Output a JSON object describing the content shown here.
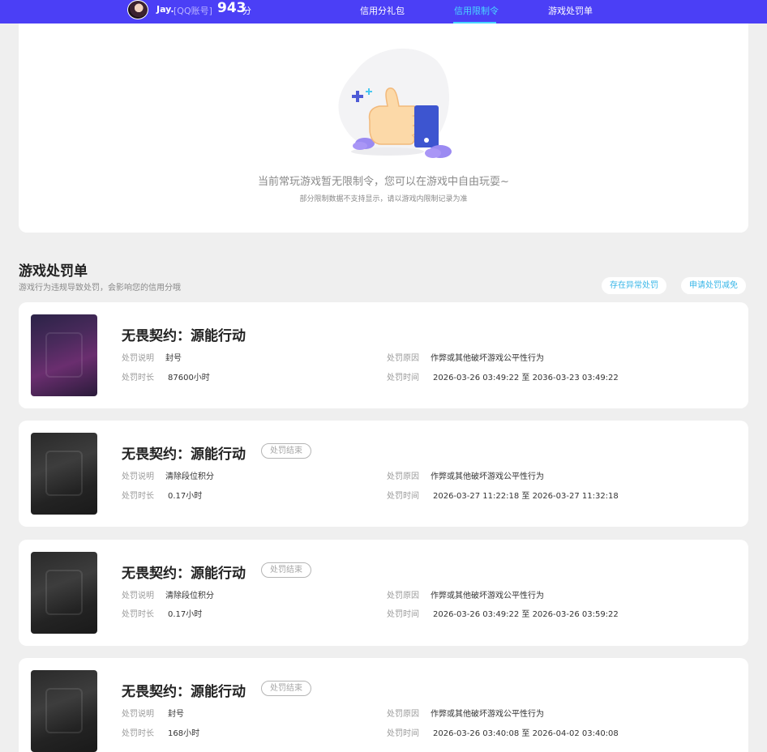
{
  "header": {
    "user_name": "Jay.",
    "account_type": "[QQ账号]",
    "score": "943",
    "score_unit": "分",
    "nav": [
      {
        "label": "信用分礼包",
        "active": false
      },
      {
        "label": "信用限制令",
        "active": true
      },
      {
        "label": "游戏处罚单",
        "active": false
      }
    ]
  },
  "hero": {
    "main_text": "当前常玩游戏暂无限制令，您可以在游戏中自由玩耍~",
    "sub_text": "部分限制数据不支持显示，请以游戏内限制记录为准"
  },
  "section": {
    "title": "游戏处罚单",
    "description": "游戏行为违规导致处罚，会影响您的信用分哦",
    "buttons": [
      "存在异常处罚",
      "申请处罚减免"
    ]
  },
  "labels": {
    "desc": "处罚说明",
    "duration": "处罚时长",
    "reason": "处罚原因",
    "time": "处罚时间",
    "ended": "处罚结束"
  },
  "punishments": [
    {
      "game": "无畏契约：源能行动",
      "ended": false,
      "desc": "封号",
      "duration": "87600小时",
      "reason": "作弊或其他破坏游戏公平性行为",
      "time": "2026-03-26 03:49:22 至 2036-03-23 03:49:22"
    },
    {
      "game": "无畏契约：源能行动",
      "ended": true,
      "desc": "清除段位积分",
      "duration": "0.17小时",
      "reason": "作弊或其他破坏游戏公平性行为",
      "time": "2026-03-27 11:22:18 至 2026-03-27 11:32:18"
    },
    {
      "game": "无畏契约：源能行动",
      "ended": true,
      "desc": "清除段位积分",
      "duration": "0.17小时",
      "reason": "作弊或其他破坏游戏公平性行为",
      "time": "2026-03-26 03:49:22 至 2026-03-26 03:59:22"
    },
    {
      "game": "无畏契约：源能行动",
      "ended": true,
      "desc": "封号",
      "duration": "168小时",
      "reason": "作弊或其他破坏游戏公平性行为",
      "time": "2026-03-26 03:40:08 至 2026-04-02 03:40:08"
    }
  ],
  "colors": {
    "topbar": "#4b3ff6",
    "nav_active": "#49d6ff",
    "link": "#3ab7e8"
  }
}
